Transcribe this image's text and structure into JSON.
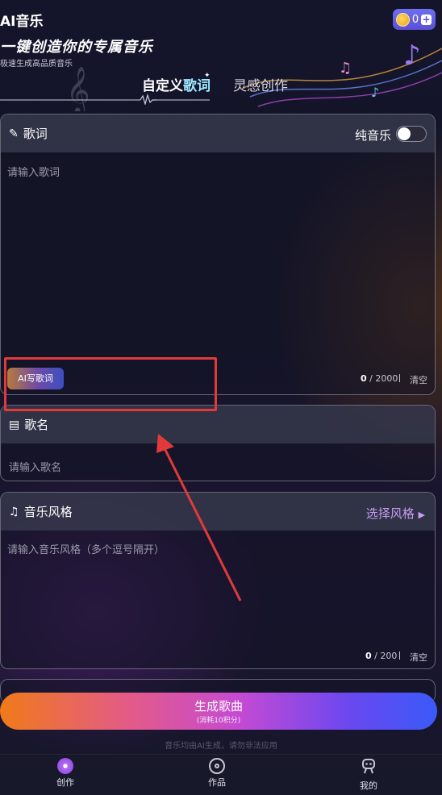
{
  "header": {
    "app_title": "AI音乐",
    "coin_count": "0",
    "add_symbol": "+",
    "hero_title": "一键创造你的专属音乐",
    "hero_subtitle": "极速生成高品质音乐"
  },
  "tabs": {
    "custom_part1": "自定义",
    "custom_part2": "歌词",
    "inspire": "灵感创作"
  },
  "lyrics": {
    "title": "歌词",
    "pure_music_label": "纯音乐",
    "pure_music_on": false,
    "placeholder": "请输入歌词",
    "ai_button": "AI写歌词",
    "count": "0",
    "max": "/ 2000",
    "clear": "清空"
  },
  "song_name": {
    "title": "歌名",
    "placeholder": "请输入歌名"
  },
  "style": {
    "title": "音乐风格",
    "select_label": "选择风格",
    "placeholder": "请输入音乐风格（多个逗号隔开）",
    "count": "0",
    "max": "/ 200",
    "clear": "清空"
  },
  "generate": {
    "label": "生成歌曲",
    "cost": "(消耗10积分)"
  },
  "disclaimer": "音乐均由AI生成，请勿非法应用",
  "nav": {
    "items": [
      {
        "label": "创作",
        "icon": "create-icon",
        "active": true
      },
      {
        "label": "作品",
        "icon": "works-icon",
        "active": false
      },
      {
        "label": "我的",
        "icon": "profile-icon",
        "active": false
      }
    ]
  },
  "colors": {
    "highlight": "#e23a3a",
    "select_accent": "#c89cf2",
    "coin_badge": "#6d6ef0"
  }
}
